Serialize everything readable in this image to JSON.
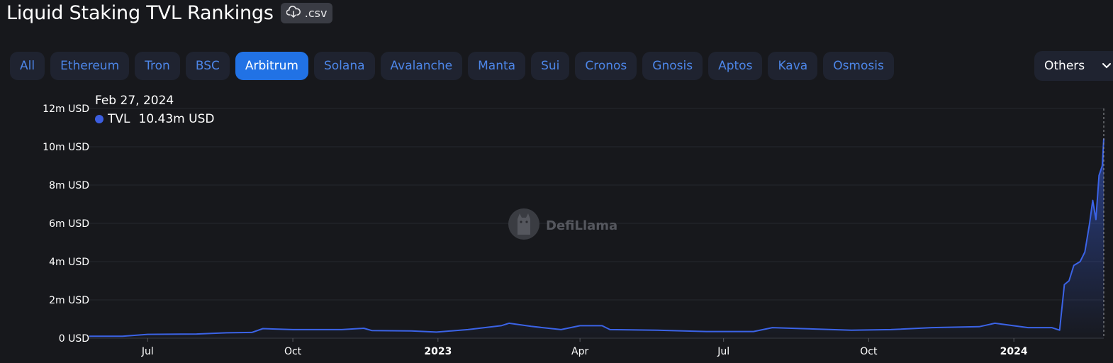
{
  "header": {
    "title": "Liquid Staking TVL Rankings",
    "csv_label": ".csv"
  },
  "tabs": [
    {
      "label": "All",
      "active": false
    },
    {
      "label": "Ethereum",
      "active": false
    },
    {
      "label": "Tron",
      "active": false
    },
    {
      "label": "BSC",
      "active": false
    },
    {
      "label": "Arbitrum",
      "active": true
    },
    {
      "label": "Solana",
      "active": false
    },
    {
      "label": "Avalanche",
      "active": false
    },
    {
      "label": "Manta",
      "active": false
    },
    {
      "label": "Sui",
      "active": false
    },
    {
      "label": "Cronos",
      "active": false
    },
    {
      "label": "Gnosis",
      "active": false
    },
    {
      "label": "Aptos",
      "active": false
    },
    {
      "label": "Kava",
      "active": false
    },
    {
      "label": "Osmosis",
      "active": false
    }
  ],
  "others_label": "Others",
  "tooltip": {
    "date": "Feb 27, 2024",
    "series": "TVL",
    "value": "10.43m USD"
  },
  "watermark": "DefiLlama",
  "colors": {
    "accent": "#2172e5",
    "line": "#3b63e6",
    "tab_text": "#4d86e8",
    "background": "#17181c"
  },
  "chart_data": {
    "type": "area",
    "series": [
      {
        "name": "TVL",
        "points": [
          [
            "2022-05-25",
            0.1
          ],
          [
            "2022-06-15",
            0.1
          ],
          [
            "2022-07-01",
            0.2
          ],
          [
            "2022-08-01",
            0.22
          ],
          [
            "2022-08-20",
            0.28
          ],
          [
            "2022-09-05",
            0.3
          ],
          [
            "2022-09-12",
            0.5
          ],
          [
            "2022-10-01",
            0.45
          ],
          [
            "2022-11-01",
            0.45
          ],
          [
            "2022-11-15",
            0.52
          ],
          [
            "2022-11-20",
            0.4
          ],
          [
            "2022-12-15",
            0.38
          ],
          [
            "2022-12-31",
            0.32
          ],
          [
            "2023-01-20",
            0.45
          ],
          [
            "2023-02-10",
            0.65
          ],
          [
            "2023-02-15",
            0.78
          ],
          [
            "2023-03-01",
            0.62
          ],
          [
            "2023-03-20",
            0.45
          ],
          [
            "2023-04-01",
            0.65
          ],
          [
            "2023-04-15",
            0.65
          ],
          [
            "2023-04-20",
            0.45
          ],
          [
            "2023-05-20",
            0.42
          ],
          [
            "2023-06-20",
            0.35
          ],
          [
            "2023-07-20",
            0.35
          ],
          [
            "2023-08-01",
            0.55
          ],
          [
            "2023-08-20",
            0.5
          ],
          [
            "2023-09-20",
            0.42
          ],
          [
            "2023-10-15",
            0.45
          ],
          [
            "2023-11-10",
            0.55
          ],
          [
            "2023-12-10",
            0.6
          ],
          [
            "2023-12-20",
            0.78
          ],
          [
            "2024-01-10",
            0.55
          ],
          [
            "2024-01-25",
            0.55
          ],
          [
            "2024-01-30",
            0.42
          ],
          [
            "2024-02-02",
            2.8
          ],
          [
            "2024-02-05",
            3.0
          ],
          [
            "2024-02-08",
            3.8
          ],
          [
            "2024-02-12",
            4.0
          ],
          [
            "2024-02-15",
            4.5
          ],
          [
            "2024-02-18",
            6.0
          ],
          [
            "2024-02-20",
            7.2
          ],
          [
            "2024-02-22",
            6.2
          ],
          [
            "2024-02-24",
            8.5
          ],
          [
            "2024-02-26",
            9.0
          ],
          [
            "2024-02-27",
            10.43
          ]
        ]
      }
    ],
    "x_ticks": [
      {
        "date": "2022-07-01",
        "label": "Jul",
        "bold": false
      },
      {
        "date": "2022-10-01",
        "label": "Oct",
        "bold": false
      },
      {
        "date": "2023-01-01",
        "label": "2023",
        "bold": true
      },
      {
        "date": "2023-04-01",
        "label": "Apr",
        "bold": false
      },
      {
        "date": "2023-07-01",
        "label": "Jul",
        "bold": false
      },
      {
        "date": "2023-10-01",
        "label": "Oct",
        "bold": false
      },
      {
        "date": "2024-01-01",
        "label": "2024",
        "bold": true
      }
    ],
    "y_ticks": [
      {
        "value": 0,
        "label": "0 USD"
      },
      {
        "value": 2,
        "label": "2m USD"
      },
      {
        "value": 4,
        "label": "4m USD"
      },
      {
        "value": 6,
        "label": "6m USD"
      },
      {
        "value": 8,
        "label": "8m USD"
      },
      {
        "value": 10,
        "label": "10m USD"
      },
      {
        "value": 12,
        "label": "12m USD"
      }
    ],
    "ylim": [
      0,
      12
    ],
    "y_unit": "m USD",
    "xlim": [
      "2022-05-25",
      "2024-02-27"
    ],
    "grid": true
  }
}
